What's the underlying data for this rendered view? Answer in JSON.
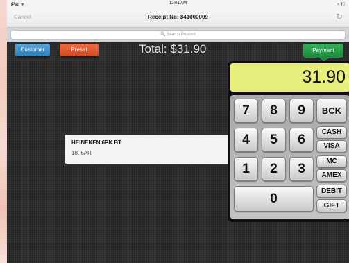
{
  "status_bar": {
    "device": "iPad ᯤ",
    "time": "12:01 AM",
    "right": "⁎ ▮▯"
  },
  "nav": {
    "cancel": "Cancel",
    "title": "Receipt No: 841000009",
    "refresh_icon": "↻"
  },
  "search": {
    "placeholder": "🔍 Search Product"
  },
  "toolbar": {
    "customer": "Customer",
    "preset": "Preset",
    "total": "Total: $31.90",
    "payment": "Payment"
  },
  "item": {
    "name": "HEINEKEN 6PK BT",
    "detail": "18, 6AR"
  },
  "keypad": {
    "display": "31.90",
    "keys": {
      "k7": "7",
      "k8": "8",
      "k9": "9",
      "k4": "4",
      "k5": "5",
      "k6": "6",
      "k1": "1",
      "k2": "2",
      "k3": "3",
      "k0": "0"
    },
    "side": {
      "bck": "BCK",
      "cash": "CASH",
      "visa": "VISA",
      "mc": "MC",
      "amex": "AMEX",
      "debit": "DEBIT",
      "gift": "GIFT"
    }
  },
  "colors": {
    "customer": "#2e7fbb",
    "preset": "#cf4a20",
    "payment": "#1a8a3c",
    "display": "#e8ee7c"
  }
}
